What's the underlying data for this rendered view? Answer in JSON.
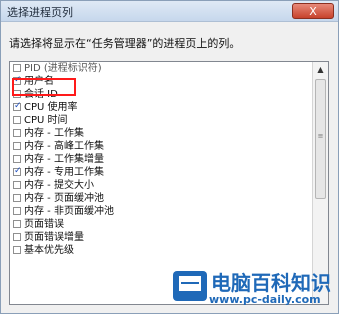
{
  "window": {
    "title": "选择进程页列",
    "close_label": "X"
  },
  "instruction": "请选择将显示在“任务管理器”的进程页上的列。",
  "columns": [
    {
      "label": "PID (进程标识符)",
      "checked": false
    },
    {
      "label": "用户名",
      "checked": true
    },
    {
      "label": "会话 ID",
      "checked": false
    },
    {
      "label": "CPU 使用率",
      "checked": true
    },
    {
      "label": "CPU 时间",
      "checked": false
    },
    {
      "label": "内存 - 工作集",
      "checked": false
    },
    {
      "label": "内存 - 高峰工作集",
      "checked": false
    },
    {
      "label": "内存 - 工作集增量",
      "checked": false
    },
    {
      "label": "内存 - 专用工作集",
      "checked": true
    },
    {
      "label": "内存 - 提交大小",
      "checked": false
    },
    {
      "label": "内存 - 页面缓冲池",
      "checked": false
    },
    {
      "label": "内存 - 非页面缓冲池",
      "checked": false
    },
    {
      "label": "页面错误",
      "checked": false
    },
    {
      "label": "页面错误增量",
      "checked": false
    },
    {
      "label": "基本优先级",
      "checked": false
    }
  ],
  "watermark": {
    "title": "电脑百科知识",
    "url": "www.pc-daily.com"
  },
  "colors": {
    "highlight": "#ff1a1a",
    "watermark": "#1f69b8"
  }
}
